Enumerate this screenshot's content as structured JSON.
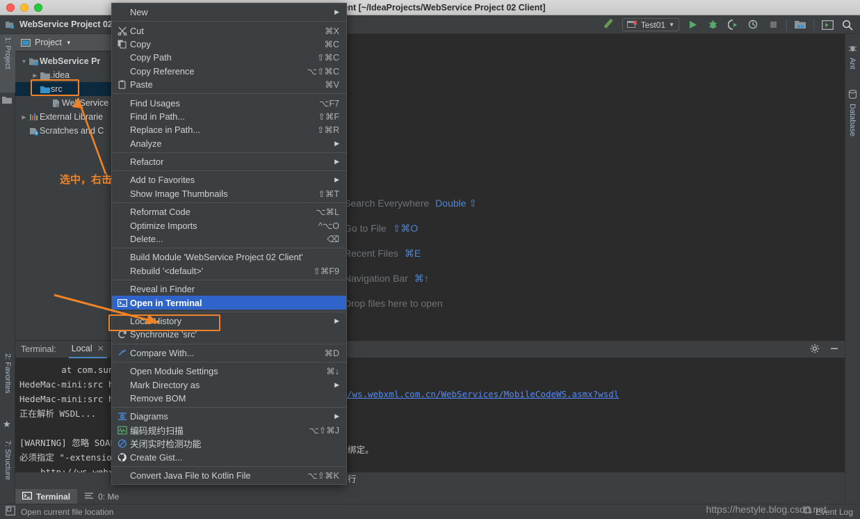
{
  "window": {
    "title": "t 02 Client [~/IdeaProjects/WebService Project 02 Client]",
    "project_name": "WebService Project 02"
  },
  "toolbar": {
    "run_config": "Test01",
    "icons": [
      "build-hammer-icon",
      "run-icon",
      "debug-icon",
      "run-coverage-icon",
      "profiler-icon",
      "stop-icon",
      "project-structure-icon",
      "terminal-window-icon",
      "search-icon"
    ]
  },
  "left_strip": {
    "tabs": [
      "1: Project",
      "2: Favorites",
      "7: Structure"
    ]
  },
  "right_strip": {
    "tabs": [
      "Ant",
      "Database"
    ]
  },
  "project_panel": {
    "header": "Project",
    "tree": [
      {
        "label": "WebService Pr",
        "indent": 0,
        "twisty": "open",
        "icon": "module-icon",
        "bold": true,
        "selected": false
      },
      {
        "label": ".idea",
        "indent": 1,
        "twisty": "closed",
        "icon": "folder-icon",
        "bold": false,
        "selected": false
      },
      {
        "label": "src",
        "indent": 1,
        "twisty": "none",
        "icon": "source-folder-icon",
        "bold": false,
        "selected": true
      },
      {
        "label": "WebService P",
        "indent": 2,
        "twisty": "none",
        "icon": "iml-file-icon",
        "bold": false,
        "selected": false
      },
      {
        "label": "External Librarie",
        "indent": 0,
        "twisty": "closed",
        "icon": "libraries-icon",
        "bold": false,
        "selected": false
      },
      {
        "label": "Scratches and C",
        "indent": 0,
        "twisty": "none",
        "icon": "scratches-icon",
        "bold": false,
        "selected": false
      }
    ]
  },
  "editor_hints": [
    {
      "label": "Search Everywhere",
      "key": "Double ⇧"
    },
    {
      "label": "Go to File",
      "key": "⇧⌘O"
    },
    {
      "label": "Recent Files",
      "key": "⌘E"
    },
    {
      "label": "Navigation Bar",
      "key": "⌘↑"
    },
    {
      "label": "Drop files here to open",
      "key": ""
    }
  ],
  "context_menu": [
    {
      "type": "item",
      "label": "New",
      "accel": "",
      "submenu": true,
      "icon": "",
      "highlight": false
    },
    {
      "type": "sep"
    },
    {
      "type": "item",
      "label": "Cut",
      "accel": "⌘X",
      "submenu": false,
      "icon": "cut-icon",
      "highlight": false
    },
    {
      "type": "item",
      "label": "Copy",
      "accel": "⌘C",
      "submenu": false,
      "icon": "copy-icon",
      "highlight": false
    },
    {
      "type": "item",
      "label": "Copy Path",
      "accel": "⇧⌘C",
      "submenu": false,
      "icon": "",
      "highlight": false
    },
    {
      "type": "item",
      "label": "Copy Reference",
      "accel": "⌥⇧⌘C",
      "submenu": false,
      "icon": "",
      "highlight": false
    },
    {
      "type": "item",
      "label": "Paste",
      "accel": "⌘V",
      "submenu": false,
      "icon": "paste-icon",
      "highlight": false
    },
    {
      "type": "sep"
    },
    {
      "type": "item",
      "label": "Find Usages",
      "accel": "⌥F7",
      "submenu": false,
      "icon": "",
      "highlight": false
    },
    {
      "type": "item",
      "label": "Find in Path...",
      "accel": "⇧⌘F",
      "submenu": false,
      "icon": "",
      "highlight": false
    },
    {
      "type": "item",
      "label": "Replace in Path...",
      "accel": "⇧⌘R",
      "submenu": false,
      "icon": "",
      "highlight": false
    },
    {
      "type": "item",
      "label": "Analyze",
      "accel": "",
      "submenu": true,
      "icon": "",
      "highlight": false
    },
    {
      "type": "sep"
    },
    {
      "type": "item",
      "label": "Refactor",
      "accel": "",
      "submenu": true,
      "icon": "",
      "highlight": false
    },
    {
      "type": "sep"
    },
    {
      "type": "item",
      "label": "Add to Favorites",
      "accel": "",
      "submenu": true,
      "icon": "",
      "highlight": false
    },
    {
      "type": "item",
      "label": "Show Image Thumbnails",
      "accel": "⇧⌘T",
      "submenu": false,
      "icon": "",
      "highlight": false
    },
    {
      "type": "sep"
    },
    {
      "type": "item",
      "label": "Reformat Code",
      "accel": "⌥⌘L",
      "submenu": false,
      "icon": "",
      "highlight": false
    },
    {
      "type": "item",
      "label": "Optimize Imports",
      "accel": "^⌥O",
      "submenu": false,
      "icon": "",
      "highlight": false
    },
    {
      "type": "item",
      "label": "Delete...",
      "accel": "⌫",
      "submenu": false,
      "icon": "",
      "highlight": false
    },
    {
      "type": "sep"
    },
    {
      "type": "item",
      "label": "Build Module 'WebService Project 02 Client'",
      "accel": "",
      "submenu": false,
      "icon": "",
      "highlight": false
    },
    {
      "type": "item",
      "label": "Rebuild '<default>'",
      "accel": "⇧⌘F9",
      "submenu": false,
      "icon": "",
      "highlight": false
    },
    {
      "type": "sep"
    },
    {
      "type": "item",
      "label": "Reveal in Finder",
      "accel": "",
      "submenu": false,
      "icon": "",
      "highlight": false
    },
    {
      "type": "item",
      "label": "Open in Terminal",
      "accel": "",
      "submenu": false,
      "icon": "terminal-icon",
      "highlight": true
    },
    {
      "type": "sep"
    },
    {
      "type": "item",
      "label": "Local History",
      "accel": "",
      "submenu": true,
      "icon": "",
      "highlight": false
    },
    {
      "type": "item",
      "label": "Synchronize 'src'",
      "accel": "",
      "submenu": false,
      "icon": "sync-icon",
      "highlight": false
    },
    {
      "type": "sep"
    },
    {
      "type": "item",
      "label": "Compare With...",
      "accel": "⌘D",
      "submenu": false,
      "icon": "compare-icon",
      "highlight": false
    },
    {
      "type": "sep"
    },
    {
      "type": "item",
      "label": "Open Module Settings",
      "accel": "⌘↓",
      "submenu": false,
      "icon": "",
      "highlight": false
    },
    {
      "type": "item",
      "label": "Mark Directory as",
      "accel": "",
      "submenu": true,
      "icon": "",
      "highlight": false
    },
    {
      "type": "item",
      "label": "Remove BOM",
      "accel": "",
      "submenu": false,
      "icon": "",
      "highlight": false
    },
    {
      "type": "sep"
    },
    {
      "type": "item",
      "label": "Diagrams",
      "accel": "",
      "submenu": true,
      "icon": "diagrams-icon",
      "highlight": false
    },
    {
      "type": "item",
      "label": "编码规约扫描",
      "accel": "⌥⇧⌘J",
      "submenu": false,
      "icon": "code-scan-icon",
      "highlight": false
    },
    {
      "type": "item",
      "label": "关闭实时检测功能",
      "accel": "",
      "submenu": false,
      "icon": "disable-inspection-icon",
      "highlight": false
    },
    {
      "type": "item",
      "label": "Create Gist...",
      "accel": "",
      "submenu": false,
      "icon": "github-icon",
      "highlight": false
    },
    {
      "type": "sep"
    },
    {
      "type": "item",
      "label": "Convert Java File to Kotlin File",
      "accel": "⌥⇧⌘K",
      "submenu": false,
      "icon": "",
      "highlight": false
    }
  ],
  "terminal": {
    "label": "Terminal:",
    "tab": "Local",
    "lines": [
      "        at com.sun.",
      "HedeMac-mini:src he",
      "HedeMac-mini:src he",
      "正在解析 WSDL...",
      "",
      "[WARNING] 忽略 SOAP",
      "必须指定 \"-extension",
      "    http://ws.webxml."
    ],
    "url_right": "/ws.webxml.com.cn/WebServices/MobileCodeWS.asmx?wsdl",
    "right_lines": [
      "绑定。",
      "行"
    ]
  },
  "bottom_tabs": [
    {
      "label": "Terminal",
      "icon": "terminal-icon",
      "selected": true
    },
    {
      "label": "0: Me",
      "icon": "messages-icon",
      "selected": false
    }
  ],
  "status_bar": {
    "left": "Open current file location",
    "event_log": "Event Log"
  },
  "annotations": {
    "select_right_click": "选中，右击",
    "watermark": "https://hestyle.blog.csdn.net",
    "accent": "#f08327"
  }
}
